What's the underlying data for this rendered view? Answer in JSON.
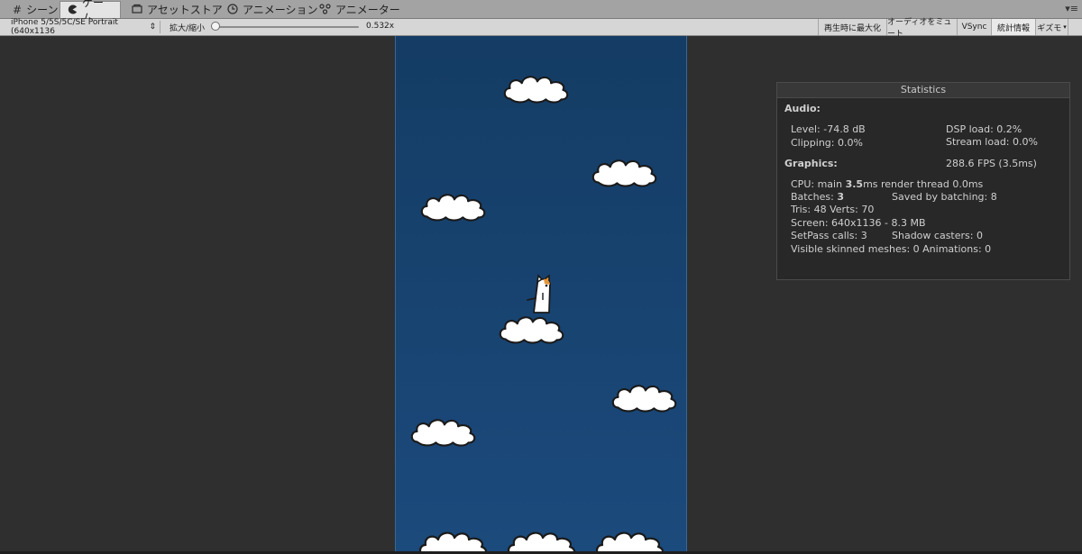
{
  "tabs": [
    {
      "label": "シーン",
      "icon": "grid-icon"
    },
    {
      "label": "ゲーム",
      "icon": "pacman-icon",
      "active": true
    },
    {
      "label": "アセットストア",
      "icon": "store-icon"
    },
    {
      "label": "アニメーション",
      "icon": "clock-icon"
    },
    {
      "label": "アニメーター",
      "icon": "animator-icon"
    }
  ],
  "toolbar": {
    "resolution": "iPhone 5/5S/5C/SE Portrait (640x1136",
    "scale_label": "拡大/縮小",
    "scale_value": "0.532x",
    "scale_level": 0.0,
    "maximize_on_play": "再生時に最大化",
    "mute_audio": "オーディオをミュート",
    "vsync": "VSync",
    "stats": "統計情報",
    "gizmos": "ギズモ"
  },
  "statistics": {
    "title": "Statistics",
    "audio_header": "Audio:",
    "level": "Level: -74.8 dB",
    "clipping": "Clipping: 0.0%",
    "dsp_load": "DSP load: 0.2%",
    "stream_load": "Stream load: 0.0%",
    "graphics_header": "Graphics:",
    "fps": "288.6 FPS (3.5ms)",
    "cpu_prefix": "CPU: main ",
    "cpu_main": "3.5",
    "cpu_suffix": "ms  render thread 0.0ms",
    "batches_prefix": "Batches: ",
    "batches": "3",
    "saved_by_batching": "Saved by batching: 8",
    "tris_verts": "Tris: 48   Verts: 70",
    "screen": "Screen: 640x1136 - 8.3 MB",
    "setpass": "SetPass calls: 3",
    "shadow_casters": "Shadow casters: 0",
    "skinned_animations": "Visible skinned meshes: 0  Animations: 0"
  }
}
